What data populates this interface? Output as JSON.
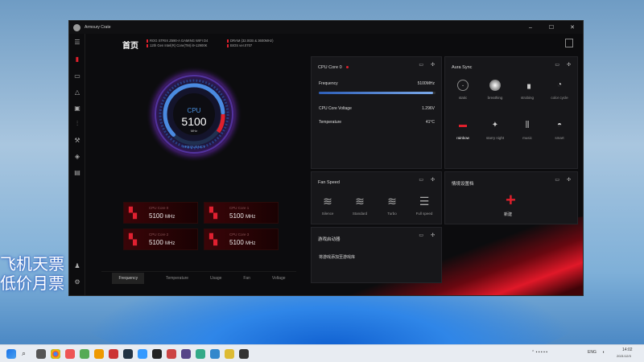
{
  "window": {
    "title": "Armoury Crate",
    "controls": [
      "–",
      "☐",
      "✕"
    ]
  },
  "header": {
    "page_title": "首页",
    "motherboard": "ROG STRIX Z690-A GAMING WIFI D4",
    "cpu": "12th Gen Intel(R) Core(TM) i9-12900K",
    "dram": "DRAM (32.0GB & 3600MHz)",
    "bios": "BIOS ver.0707"
  },
  "gauge": {
    "label": "CPU",
    "value": "5100",
    "unit": "MHz",
    "caption": "FREQUENCY",
    "level": 0.82
  },
  "cores": [
    {
      "name": "CPU Core 0",
      "value": "5100",
      "unit": "MHz"
    },
    {
      "name": "CPU Core 1",
      "value": "5100",
      "unit": "MHz"
    },
    {
      "name": "CPU Core 2",
      "value": "5100",
      "unit": "MHz"
    },
    {
      "name": "CPU Core 3",
      "value": "5100",
      "unit": "MHz"
    }
  ],
  "bottom_tabs": [
    "Frequency",
    "Temperature",
    "Usage",
    "Fan",
    "Voltage"
  ],
  "cpu_card": {
    "title": "CPU Core 0",
    "frequency_label": "Frequency",
    "frequency_value": "5100MHz",
    "frequency_level": 0.98,
    "voltage_label": "CPU Core Voltage",
    "voltage_value": "1.296V",
    "temp_label": "Temperature",
    "temp_value": "41°C"
  },
  "aura": {
    "title": "Aura Sync",
    "effects": [
      "static",
      "breathing",
      "strobing",
      "color cycle",
      "rainbow",
      "starry night",
      "music",
      "smart"
    ],
    "selected": "rainbow"
  },
  "fan": {
    "title": "Fan Speed",
    "modes": [
      "Silence",
      "Standard",
      "Turbo",
      "Full speed"
    ]
  },
  "scenario": {
    "title": "情境设置档",
    "new_label": "新建"
  },
  "game": {
    "title": "游戏启动器",
    "text": "将游戏添加至游戏库"
  },
  "watermark": [
    "飞机天票",
    "低价月票"
  ],
  "tray": {
    "lang": "ENG",
    "time": "14:02",
    "date": "2021/12/3"
  },
  "colors": {
    "accent": "#e0202c",
    "bg": "#0c0c0e",
    "card": "#17171a"
  }
}
